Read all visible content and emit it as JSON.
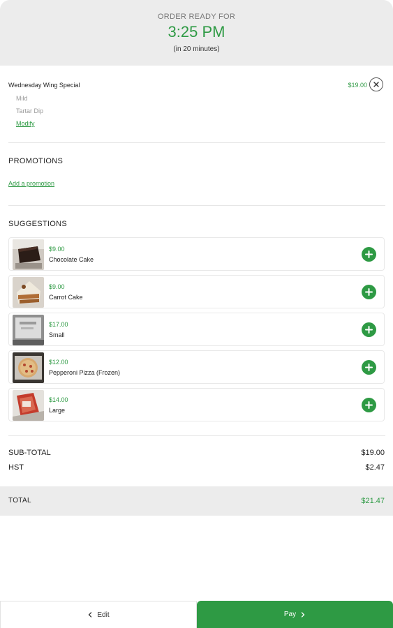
{
  "header": {
    "label": "ORDER READY FOR",
    "time": "3:25 PM",
    "eta": "(in 20 minutes)"
  },
  "order": {
    "item_name": "Wednesday Wing Special",
    "item_price": "$19.00",
    "modifiers": [
      "Mild",
      "Tartar Dip"
    ],
    "modify_label": "Modify"
  },
  "promotions": {
    "title": "PROMOTIONS",
    "add_label": "Add a promotion"
  },
  "suggestions": {
    "title": "SUGGESTIONS",
    "items": [
      {
        "price": "$9.00",
        "name": "Chocolate Cake"
      },
      {
        "price": "$9.00",
        "name": "Carrot Cake"
      },
      {
        "price": "$17.00",
        "name": "Small"
      },
      {
        "price": "$12.00",
        "name": "Pepperoni Pizza (Frozen)"
      },
      {
        "price": "$14.00",
        "name": "Large"
      }
    ]
  },
  "summary": {
    "subtotal_label": "SUB-TOTAL",
    "subtotal_value": "$19.00",
    "tax_label": "HST",
    "tax_value": "$2.47",
    "total_label": "TOTAL",
    "total_value": "$21.47"
  },
  "actions": {
    "edit_label": "Edit",
    "pay_label": "Pay"
  },
  "colors": {
    "accent": "#2e9a44",
    "header_bg": "#ececec"
  }
}
